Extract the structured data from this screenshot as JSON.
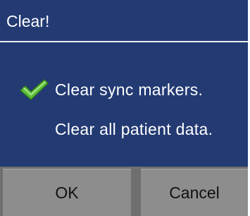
{
  "dialog": {
    "title": "Clear!",
    "options": [
      {
        "label": "Clear sync markers.",
        "selected": true,
        "icon": "check-icon"
      },
      {
        "label": "Clear all patient data.",
        "selected": false
      }
    ],
    "buttons": {
      "ok_label": "OK",
      "cancel_label": "Cancel"
    },
    "colors": {
      "background": "#233a73",
      "text": "#ffffff",
      "button": "#8d8d8d",
      "check": "#5fbf3a"
    }
  }
}
